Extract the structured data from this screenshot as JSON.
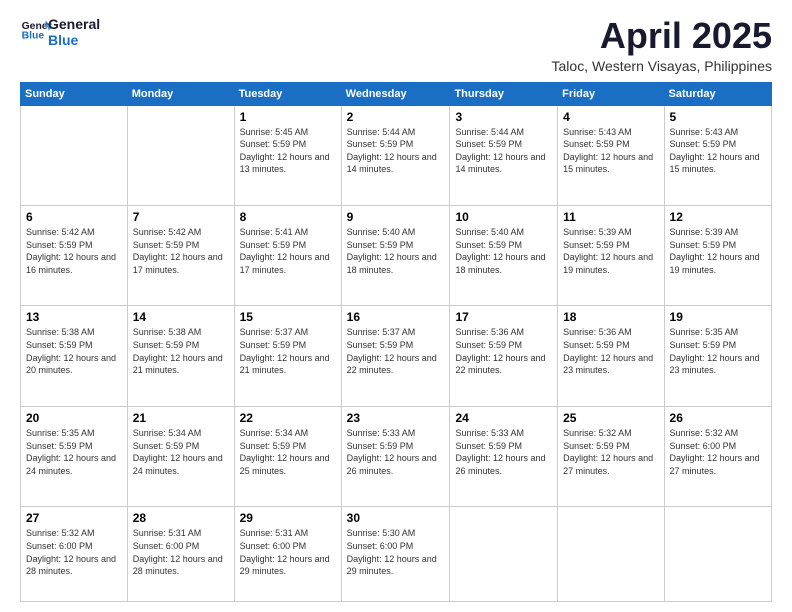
{
  "logo": {
    "line1": "General",
    "line2": "Blue"
  },
  "title": "April 2025",
  "subtitle": "Taloc, Western Visayas, Philippines",
  "weekdays": [
    "Sunday",
    "Monday",
    "Tuesday",
    "Wednesday",
    "Thursday",
    "Friday",
    "Saturday"
  ],
  "weeks": [
    [
      {
        "day": "",
        "info": ""
      },
      {
        "day": "",
        "info": ""
      },
      {
        "day": "1",
        "info": "Sunrise: 5:45 AM\nSunset: 5:59 PM\nDaylight: 12 hours\nand 13 minutes."
      },
      {
        "day": "2",
        "info": "Sunrise: 5:44 AM\nSunset: 5:59 PM\nDaylight: 12 hours\nand 14 minutes."
      },
      {
        "day": "3",
        "info": "Sunrise: 5:44 AM\nSunset: 5:59 PM\nDaylight: 12 hours\nand 14 minutes."
      },
      {
        "day": "4",
        "info": "Sunrise: 5:43 AM\nSunset: 5:59 PM\nDaylight: 12 hours\nand 15 minutes."
      },
      {
        "day": "5",
        "info": "Sunrise: 5:43 AM\nSunset: 5:59 PM\nDaylight: 12 hours\nand 15 minutes."
      }
    ],
    [
      {
        "day": "6",
        "info": "Sunrise: 5:42 AM\nSunset: 5:59 PM\nDaylight: 12 hours\nand 16 minutes."
      },
      {
        "day": "7",
        "info": "Sunrise: 5:42 AM\nSunset: 5:59 PM\nDaylight: 12 hours\nand 17 minutes."
      },
      {
        "day": "8",
        "info": "Sunrise: 5:41 AM\nSunset: 5:59 PM\nDaylight: 12 hours\nand 17 minutes."
      },
      {
        "day": "9",
        "info": "Sunrise: 5:40 AM\nSunset: 5:59 PM\nDaylight: 12 hours\nand 18 minutes."
      },
      {
        "day": "10",
        "info": "Sunrise: 5:40 AM\nSunset: 5:59 PM\nDaylight: 12 hours\nand 18 minutes."
      },
      {
        "day": "11",
        "info": "Sunrise: 5:39 AM\nSunset: 5:59 PM\nDaylight: 12 hours\nand 19 minutes."
      },
      {
        "day": "12",
        "info": "Sunrise: 5:39 AM\nSunset: 5:59 PM\nDaylight: 12 hours\nand 19 minutes."
      }
    ],
    [
      {
        "day": "13",
        "info": "Sunrise: 5:38 AM\nSunset: 5:59 PM\nDaylight: 12 hours\nand 20 minutes."
      },
      {
        "day": "14",
        "info": "Sunrise: 5:38 AM\nSunset: 5:59 PM\nDaylight: 12 hours\nand 21 minutes."
      },
      {
        "day": "15",
        "info": "Sunrise: 5:37 AM\nSunset: 5:59 PM\nDaylight: 12 hours\nand 21 minutes."
      },
      {
        "day": "16",
        "info": "Sunrise: 5:37 AM\nSunset: 5:59 PM\nDaylight: 12 hours\nand 22 minutes."
      },
      {
        "day": "17",
        "info": "Sunrise: 5:36 AM\nSunset: 5:59 PM\nDaylight: 12 hours\nand 22 minutes."
      },
      {
        "day": "18",
        "info": "Sunrise: 5:36 AM\nSunset: 5:59 PM\nDaylight: 12 hours\nand 23 minutes."
      },
      {
        "day": "19",
        "info": "Sunrise: 5:35 AM\nSunset: 5:59 PM\nDaylight: 12 hours\nand 23 minutes."
      }
    ],
    [
      {
        "day": "20",
        "info": "Sunrise: 5:35 AM\nSunset: 5:59 PM\nDaylight: 12 hours\nand 24 minutes."
      },
      {
        "day": "21",
        "info": "Sunrise: 5:34 AM\nSunset: 5:59 PM\nDaylight: 12 hours\nand 24 minutes."
      },
      {
        "day": "22",
        "info": "Sunrise: 5:34 AM\nSunset: 5:59 PM\nDaylight: 12 hours\nand 25 minutes."
      },
      {
        "day": "23",
        "info": "Sunrise: 5:33 AM\nSunset: 5:59 PM\nDaylight: 12 hours\nand 26 minutes."
      },
      {
        "day": "24",
        "info": "Sunrise: 5:33 AM\nSunset: 5:59 PM\nDaylight: 12 hours\nand 26 minutes."
      },
      {
        "day": "25",
        "info": "Sunrise: 5:32 AM\nSunset: 5:59 PM\nDaylight: 12 hours\nand 27 minutes."
      },
      {
        "day": "26",
        "info": "Sunrise: 5:32 AM\nSunset: 6:00 PM\nDaylight: 12 hours\nand 27 minutes."
      }
    ],
    [
      {
        "day": "27",
        "info": "Sunrise: 5:32 AM\nSunset: 6:00 PM\nDaylight: 12 hours\nand 28 minutes."
      },
      {
        "day": "28",
        "info": "Sunrise: 5:31 AM\nSunset: 6:00 PM\nDaylight: 12 hours\nand 28 minutes."
      },
      {
        "day": "29",
        "info": "Sunrise: 5:31 AM\nSunset: 6:00 PM\nDaylight: 12 hours\nand 29 minutes."
      },
      {
        "day": "30",
        "info": "Sunrise: 5:30 AM\nSunset: 6:00 PM\nDaylight: 12 hours\nand 29 minutes."
      },
      {
        "day": "",
        "info": ""
      },
      {
        "day": "",
        "info": ""
      },
      {
        "day": "",
        "info": ""
      }
    ]
  ]
}
